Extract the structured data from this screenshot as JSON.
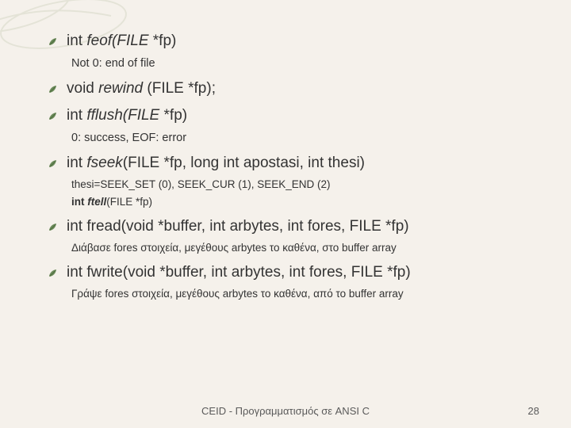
{
  "items": [
    {
      "level": 1,
      "segments": [
        {
          "t": "int ",
          "i": false,
          "b": false
        },
        {
          "t": "feof(FILE ",
          "i": true,
          "b": false
        },
        {
          "t": "*fp)",
          "i": false,
          "b": false
        }
      ]
    },
    {
      "level": 2,
      "size": "l2",
      "segments": [
        {
          "t": "Not 0: end of file",
          "i": false,
          "b": false
        }
      ]
    },
    {
      "level": 1,
      "segments": [
        {
          "t": "void ",
          "i": false,
          "b": false
        },
        {
          "t": "rewind ",
          "i": true,
          "b": false
        },
        {
          "t": "(FILE *fp);",
          "i": false,
          "b": false
        }
      ]
    },
    {
      "level": 1,
      "segments": [
        {
          "t": "int ",
          "i": false,
          "b": false
        },
        {
          "t": "fflush(FILE ",
          "i": true,
          "b": false
        },
        {
          "t": "*fp)",
          "i": false,
          "b": false
        }
      ]
    },
    {
      "level": 2,
      "size": "l2",
      "segments": [
        {
          "t": "0: success, EOF: error",
          "i": false,
          "b": false
        }
      ]
    },
    {
      "level": 1,
      "segments": [
        {
          "t": "int ",
          "i": false,
          "b": false
        },
        {
          "t": "fseek",
          "i": true,
          "b": false
        },
        {
          "t": "(FILE *fp, long int apostasi, int thesi)",
          "i": false,
          "b": false
        }
      ]
    },
    {
      "level": 2,
      "size": "l2b",
      "segments": [
        {
          "t": "thesi=SEEK_SET (0), SEEK_CUR (1), SEEK_END (2)",
          "i": false,
          "b": false
        }
      ]
    },
    {
      "level": 2,
      "size": "l2b",
      "segments": [
        {
          "t": "int ",
          "i": false,
          "b": true
        },
        {
          "t": "ftell",
          "i": true,
          "b": true
        },
        {
          "t": "(FILE *fp)",
          "i": false,
          "b": false
        }
      ]
    },
    {
      "level": 1,
      "segments": [
        {
          "t": "int fread(void *buffer, int arbytes, int fores, FILE *fp)",
          "i": false,
          "b": false
        }
      ]
    },
    {
      "level": 2,
      "size": "l2b",
      "segments": [
        {
          "t": "Διάβασε fores στοιχεία, μεγέθους arbytes το καθένα, στο buffer array",
          "i": false,
          "b": false
        }
      ]
    },
    {
      "level": 1,
      "segments": [
        {
          "t": "int fwrite(void *buffer, int arbytes, int fores, FILE *fp)",
          "i": false,
          "b": false
        }
      ]
    },
    {
      "level": 2,
      "size": "l2b",
      "segments": [
        {
          "t": "Γράψε fores στοιχεία, μεγέθους arbytes το καθένα, από το buffer array",
          "i": false,
          "b": false
        }
      ]
    }
  ],
  "footer": {
    "center": "CEID - Προγραμματισμός σε ANSI C",
    "page": "28"
  }
}
